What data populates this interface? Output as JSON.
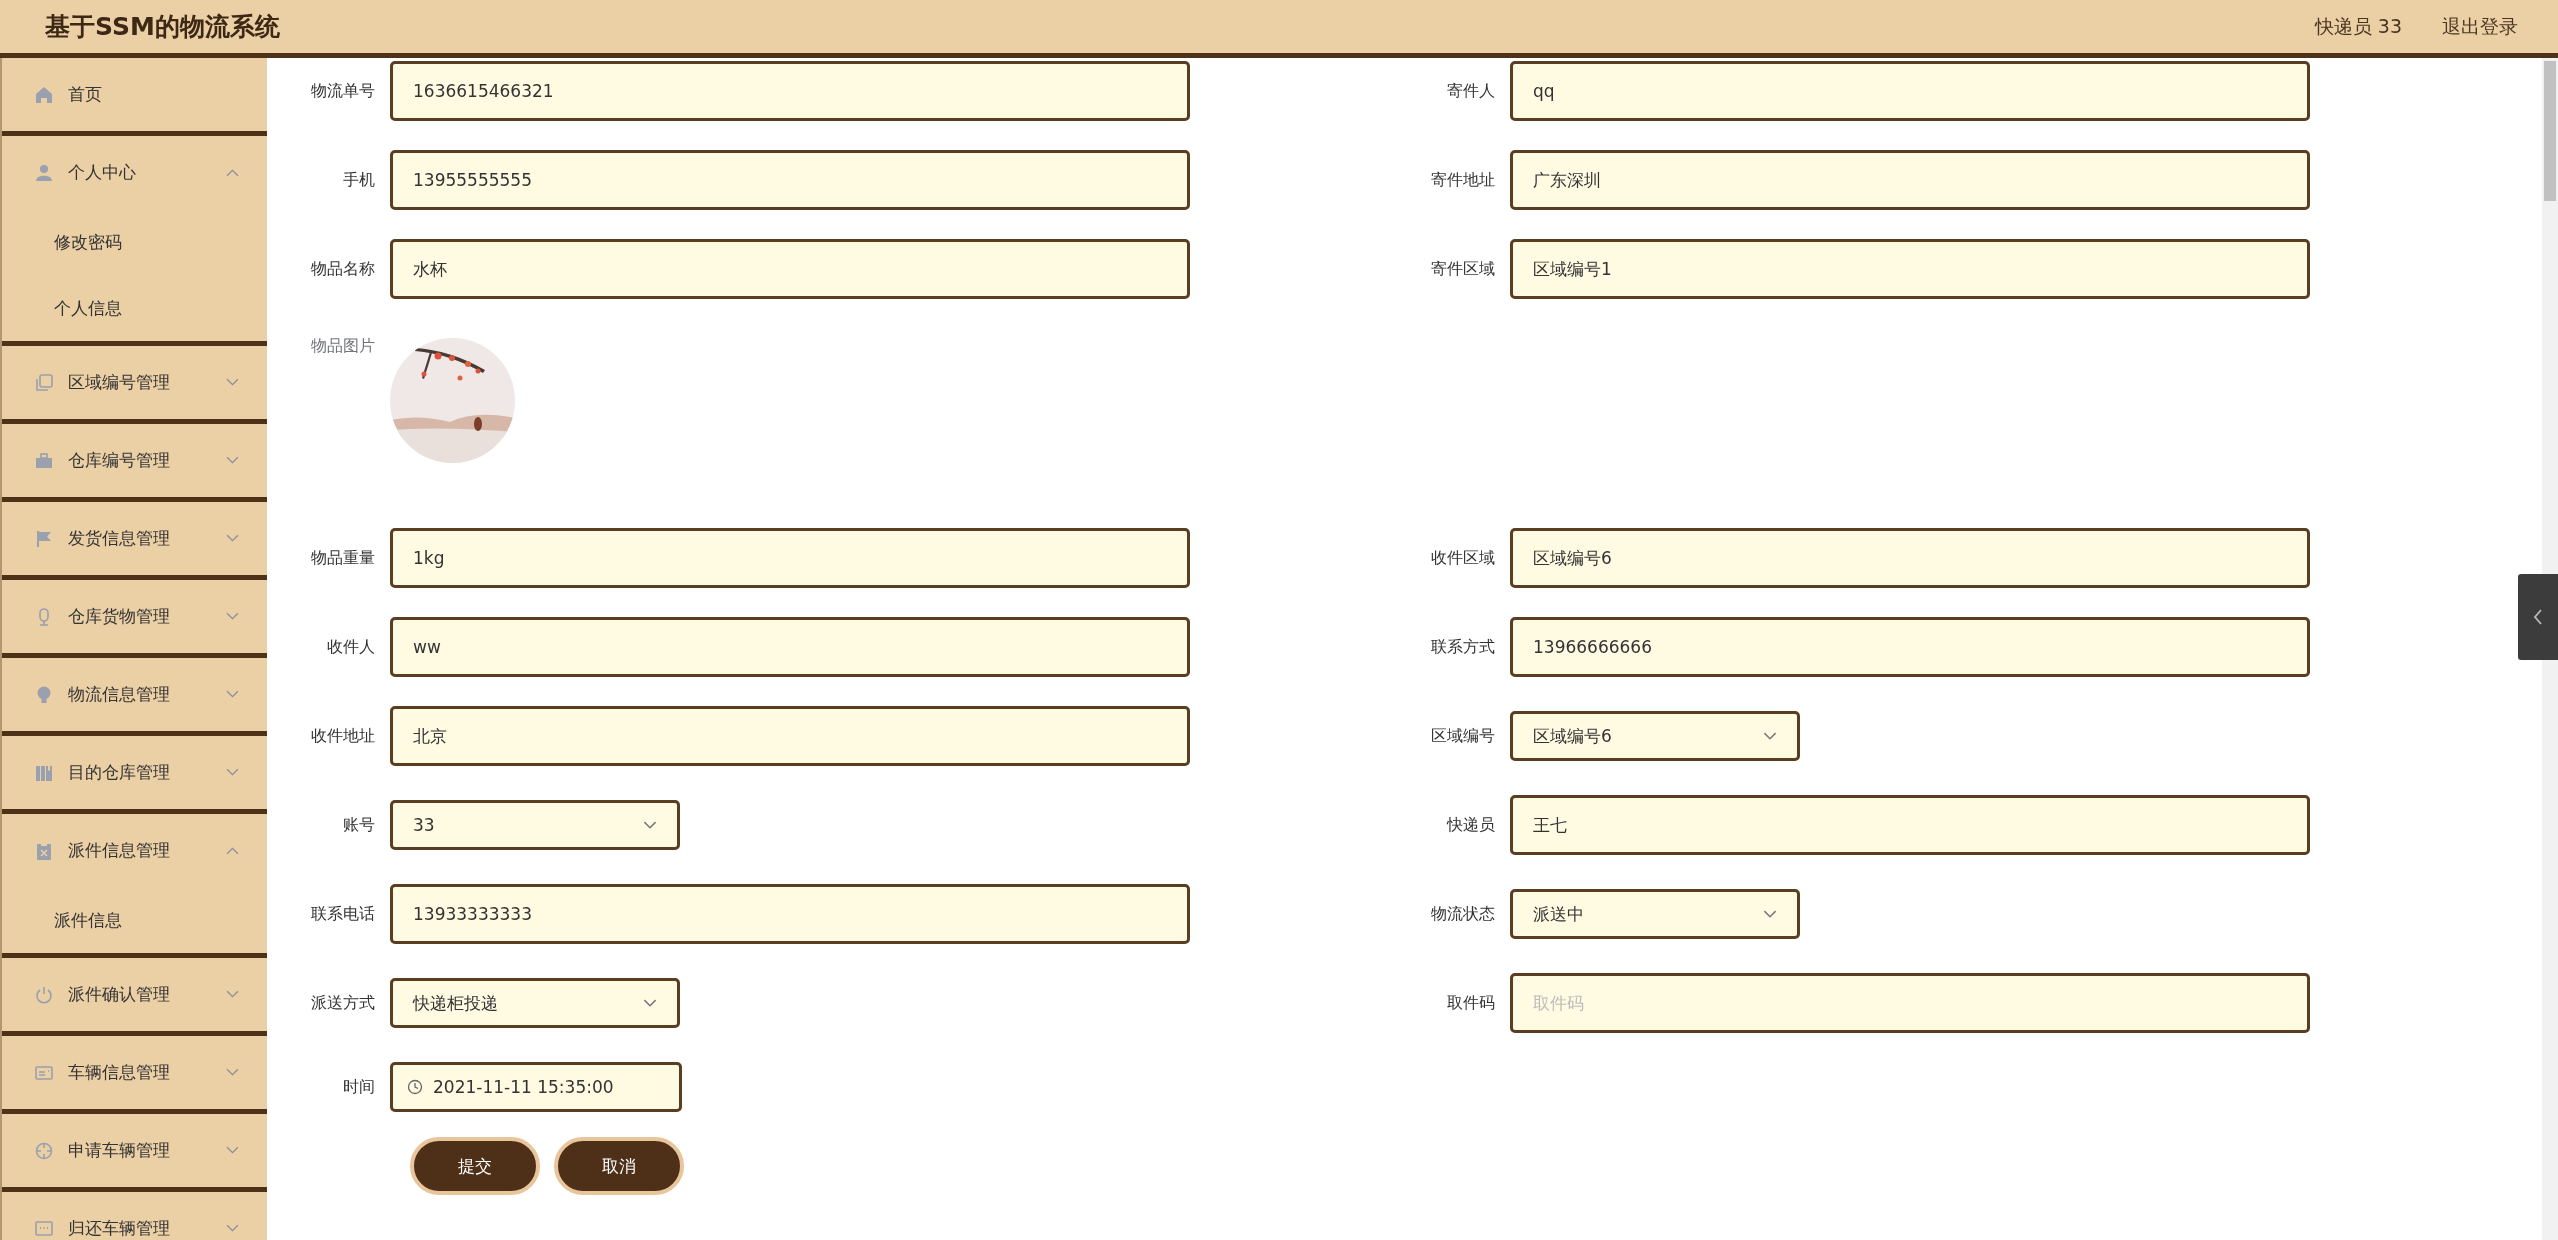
{
  "header": {
    "title": "基于SSM的物流系统",
    "user": "快递员 33",
    "logout": "退出登录"
  },
  "sidebar": {
    "items": [
      {
        "label": "首页",
        "kind": "link"
      },
      {
        "label": "个人中心",
        "kind": "menu",
        "expanded": true,
        "children": [
          {
            "label": "修改密码"
          },
          {
            "label": "个人信息"
          }
        ]
      },
      {
        "label": "区域编号管理",
        "kind": "menu",
        "expanded": false
      },
      {
        "label": "仓库编号管理",
        "kind": "menu",
        "expanded": false
      },
      {
        "label": "发货信息管理",
        "kind": "menu",
        "expanded": false
      },
      {
        "label": "仓库货物管理",
        "kind": "menu",
        "expanded": false
      },
      {
        "label": "物流信息管理",
        "kind": "menu",
        "expanded": false
      },
      {
        "label": "目的仓库管理",
        "kind": "menu",
        "expanded": false
      },
      {
        "label": "派件信息管理",
        "kind": "menu",
        "expanded": true,
        "children": [
          {
            "label": "派件信息"
          }
        ]
      },
      {
        "label": "派件确认管理",
        "kind": "menu",
        "expanded": false
      },
      {
        "label": "车辆信息管理",
        "kind": "menu",
        "expanded": false
      },
      {
        "label": "申请车辆管理",
        "kind": "menu",
        "expanded": false
      },
      {
        "label": "归还车辆管理",
        "kind": "menu",
        "expanded": false
      }
    ]
  },
  "form": {
    "rows": [
      {
        "fields": [
          {
            "label": "物流单号",
            "kind": "text",
            "value": "1636615466321"
          },
          {
            "label": "寄件人",
            "kind": "text",
            "value": "qq"
          }
        ]
      },
      {
        "fields": [
          {
            "label": "手机",
            "kind": "text",
            "value": "13955555555"
          },
          {
            "label": "寄件地址",
            "kind": "text",
            "value": "广东深圳"
          }
        ]
      },
      {
        "fields": [
          {
            "label": "物品名称",
            "kind": "text",
            "value": "水杯"
          },
          {
            "label": "寄件区域",
            "kind": "text",
            "value": "区域编号1"
          }
        ]
      },
      {
        "fields": [
          {
            "label": "物品图片"
          }
        ]
      },
      {
        "fields": [
          {
            "label": "物品重量",
            "kind": "text",
            "value": "1kg"
          },
          {
            "label": "收件区域",
            "kind": "text",
            "value": "区域编号6"
          }
        ]
      },
      {
        "fields": [
          {
            "label": "收件人",
            "kind": "text",
            "value": "ww"
          },
          {
            "label": "联系方式",
            "kind": "text",
            "value": "13966666666"
          }
        ]
      },
      {
        "fields": [
          {
            "label": "收件地址",
            "kind": "text",
            "value": "北京"
          },
          {
            "label": "区域编号",
            "kind": "select",
            "value": "区域编号6"
          }
        ]
      },
      {
        "fields": [
          {
            "label": "账号",
            "kind": "select",
            "value": "33"
          },
          {
            "label": "快递员",
            "kind": "text",
            "value": "王七"
          }
        ]
      },
      {
        "fields": [
          {
            "label": "联系电话",
            "kind": "text",
            "value": "13933333333"
          },
          {
            "label": "物流状态",
            "kind": "select",
            "value": "派送中"
          }
        ]
      },
      {
        "fields": [
          {
            "label": "派送方式",
            "kind": "select",
            "value": "快递柜投递"
          },
          {
            "label": "取件码",
            "kind": "text",
            "placeholder": "取件码"
          }
        ]
      },
      {
        "fields": [
          {
            "label": "时间",
            "kind": "date",
            "value": "2021-11-11 15:35:00"
          }
        ]
      }
    ],
    "buttons": [
      "提交",
      "取消"
    ]
  }
}
